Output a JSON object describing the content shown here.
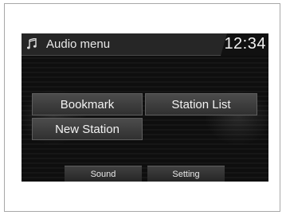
{
  "header": {
    "icon": "music-note-icon",
    "title": "Audio menu",
    "clock": "12:34"
  },
  "menu": {
    "bookmark": "Bookmark",
    "station_list": "Station List",
    "new_station": "New Station"
  },
  "footer": {
    "sound": "Sound",
    "setting": "Setting"
  }
}
